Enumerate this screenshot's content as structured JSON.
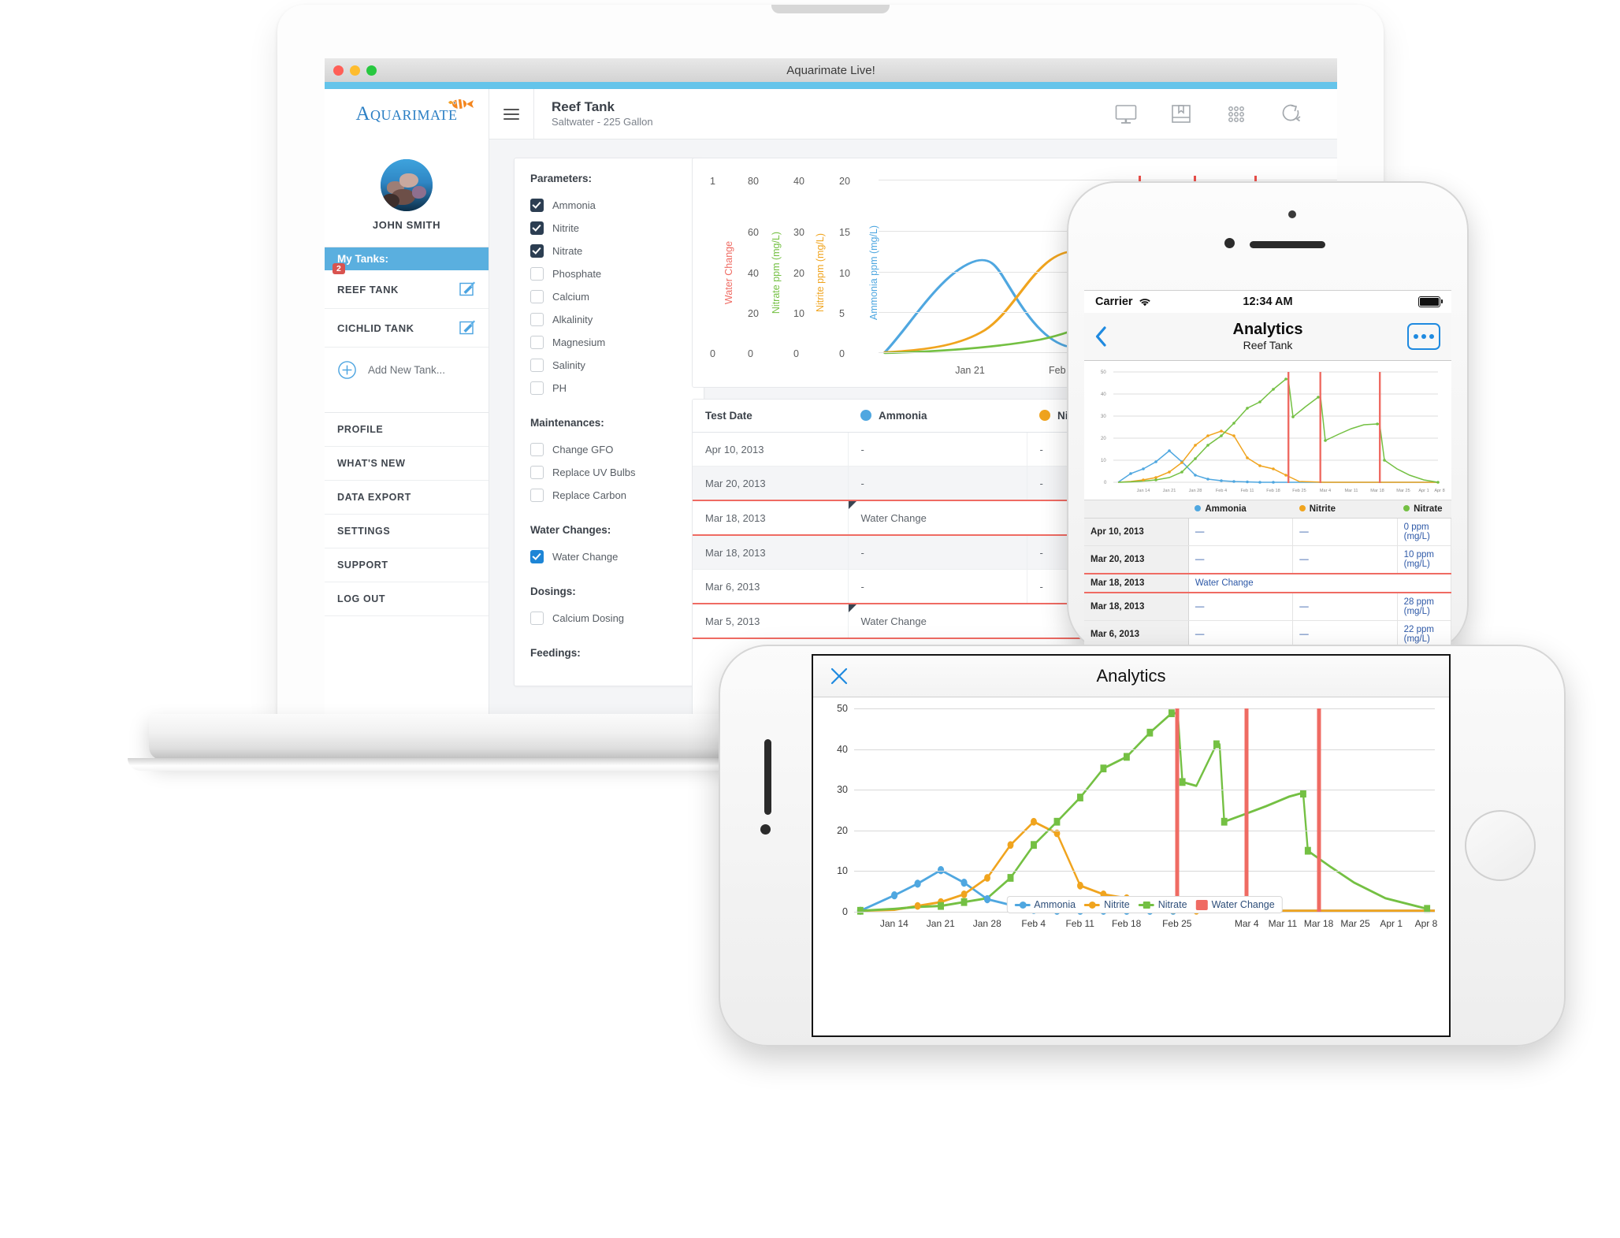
{
  "window": {
    "title": "Aquarimate Live!",
    "traffic_lights": [
      "close",
      "minimize",
      "zoom"
    ]
  },
  "brand": {
    "logo_text": "Aquarimate",
    "logo_icon": "clownfish-icon"
  },
  "header": {
    "menu_icon": "hamburger-icon",
    "tank_name": "Reef Tank",
    "tank_subtitle": "Saltwater - 225 Gallon",
    "icons": [
      "monitor-icon",
      "journal-icon",
      "grid-icon",
      "refresh-icon"
    ]
  },
  "sidebar": {
    "user_name": "JOHN SMITH",
    "section_label": "My Tanks:",
    "tanks": [
      {
        "label": "REEF TANK",
        "badge": "2",
        "edit_icon": "edit-pencil-icon"
      },
      {
        "label": "CICHLID TANK",
        "badge": "",
        "edit_icon": "edit-pencil-icon"
      }
    ],
    "add_tank_label": "Add New Tank...",
    "add_tank_icon": "plus-circle-icon",
    "nav": [
      "PROFILE",
      "WHAT'S NEW",
      "DATA EXPORT",
      "SETTINGS",
      "SUPPORT",
      "LOG OUT"
    ]
  },
  "filters": {
    "groups": [
      {
        "title": "Parameters:",
        "items": [
          {
            "label": "Ammonia",
            "checked": true,
            "style": "dark"
          },
          {
            "label": "Nitrite",
            "checked": true,
            "style": "dark"
          },
          {
            "label": "Nitrate",
            "checked": true,
            "style": "dark"
          },
          {
            "label": "Phosphate",
            "checked": false,
            "style": ""
          },
          {
            "label": "Calcium",
            "checked": false,
            "style": ""
          },
          {
            "label": "Alkalinity",
            "checked": false,
            "style": ""
          },
          {
            "label": "Magnesium",
            "checked": false,
            "style": ""
          },
          {
            "label": "Salinity",
            "checked": false,
            "style": ""
          },
          {
            "label": "PH",
            "checked": false,
            "style": ""
          }
        ]
      },
      {
        "title": "Maintenances:",
        "items": [
          {
            "label": "Change GFO",
            "checked": false,
            "style": ""
          },
          {
            "label": "Replace UV Bulbs",
            "checked": false,
            "style": ""
          },
          {
            "label": "Replace Carbon",
            "checked": false,
            "style": ""
          }
        ]
      },
      {
        "title": "Water Changes:",
        "items": [
          {
            "label": "Water Change",
            "checked": true,
            "style": "blue"
          }
        ]
      },
      {
        "title": "Dosings:",
        "items": [
          {
            "label": "Calcium Dosing",
            "checked": false,
            "style": ""
          }
        ]
      },
      {
        "title": "Feedings:",
        "items": []
      }
    ]
  },
  "desktop_table": {
    "columns": [
      "Test Date",
      "Ammonia",
      "Nitrite"
    ],
    "column_dot_colors": [
      "",
      "#4fa7e0",
      "#f0a41e"
    ],
    "rows": [
      {
        "date": "Apr 10, 2013",
        "ammonia": "-",
        "nitrite": "-",
        "type": "data"
      },
      {
        "date": "Mar 20, 2013",
        "ammonia": "-",
        "nitrite": "-",
        "type": "data"
      },
      {
        "date": "Mar 18, 2013",
        "ammonia": "Water Change",
        "nitrite": "",
        "type": "water_change"
      },
      {
        "date": "Mar 18, 2013",
        "ammonia": "-",
        "nitrite": "-",
        "type": "data"
      },
      {
        "date": "Mar 6, 2013",
        "ammonia": "-",
        "nitrite": "-",
        "type": "data"
      },
      {
        "date": "Mar 5, 2013",
        "ammonia": "Water Change",
        "nitrite": "",
        "type": "water_change"
      }
    ]
  },
  "phone_portrait": {
    "status": {
      "carrier": "Carrier",
      "wifi_icon": "wifi-icon",
      "time": "12:34 AM",
      "battery_icon": "battery-full-icon"
    },
    "nav": {
      "back_icon": "chevron-left-icon",
      "title": "Analytics",
      "subtitle": "Reef Tank",
      "more_icon": "more-dots-icon"
    },
    "table": {
      "columns": [
        "",
        "Ammonia",
        "Nitrite",
        "Nitrate"
      ],
      "column_dot_colors": [
        "",
        "#4fa7e0",
        "#f0a41e",
        "#74c043"
      ],
      "rows": [
        {
          "date": "Apr 10, 2013",
          "ammonia": "—",
          "nitrite": "—",
          "nitrate": "0 ppm (mg/L)",
          "type": "data"
        },
        {
          "date": "Mar 20, 2013",
          "ammonia": "—",
          "nitrite": "—",
          "nitrate": "10 ppm (mg/L)",
          "type": "data"
        },
        {
          "date": "Mar 18, 2013",
          "ammonia": "Water Change",
          "nitrite": "",
          "nitrate": "",
          "type": "water_change"
        },
        {
          "date": "Mar 18, 2013",
          "ammonia": "—",
          "nitrite": "—",
          "nitrate": "28 ppm (mg/L)",
          "type": "data"
        },
        {
          "date": "Mar 6, 2013",
          "ammonia": "—",
          "nitrite": "—",
          "nitrate": "22 ppm (mg/L)",
          "type": "data"
        }
      ]
    }
  },
  "phone_landscape": {
    "nav": {
      "close_icon": "close-x-icon",
      "title": "Analytics"
    }
  },
  "colors": {
    "ammonia": "#4fa7e0",
    "nitrite": "#f0a41e",
    "nitrate": "#74c043",
    "water_change": "#ef6b63",
    "accent": "#5aafdf",
    "brand_blue": "#2b7fc4",
    "badge_red": "#d9534f"
  },
  "chart_data": [
    {
      "id": "landscape_phone_chart",
      "type": "line",
      "title": "Analytics",
      "xlabel": "",
      "ylabel": "",
      "ylim": [
        0,
        50
      ],
      "yticks": [
        0,
        10,
        20,
        30,
        40,
        50
      ],
      "grid": true,
      "legend_position": "bottom",
      "x": [
        "Jan 7",
        "Jan 14",
        "Jan 17",
        "Jan 21",
        "Jan 24",
        "Jan 28",
        "Jan 31",
        "Feb 4",
        "Feb 8",
        "Feb 11",
        "Feb 14",
        "Feb 18",
        "Feb 21",
        "Feb 25",
        "Feb 25b",
        "Feb 28",
        "Mar 4",
        "Mar 4b",
        "Mar 8",
        "Mar 14",
        "Mar 18",
        "Mar 18b",
        "Mar 21",
        "Mar 25",
        "Apr 1",
        "Apr 8"
      ],
      "xticks": [
        "Jan 14",
        "Jan 21",
        "Jan 28",
        "Feb 4",
        "Feb 11",
        "Feb 18",
        "Feb 25",
        "Mar 4",
        "Mar 11",
        "Mar 18",
        "Mar 25",
        "Apr 1",
        "Apr 8"
      ],
      "series": [
        {
          "name": "Ammonia",
          "color": "#4fa7e0",
          "marker": "circle",
          "values": [
            0,
            4,
            6.8,
            10.1,
            7.1,
            3.1,
            1.5,
            0.5,
            0.15,
            0.1,
            0.1,
            0.1,
            0.05,
            0,
            0,
            0,
            0,
            0,
            0,
            0,
            0,
            0,
            0,
            0,
            0,
            0
          ]
        },
        {
          "name": "Nitrite",
          "color": "#f0a41e",
          "marker": "plus",
          "values": [
            0,
            0.3,
            1.1,
            2.2,
            4.1,
            8,
            16.1,
            22,
            19,
            6.2,
            4.1,
            3.1,
            1.7,
            0.15,
            0.1,
            0.1,
            0.05,
            0,
            0,
            0,
            0,
            0,
            0,
            0,
            0,
            0
          ]
        },
        {
          "name": "Nitrate",
          "color": "#74c043",
          "marker": "square",
          "values": [
            0.1,
            0.3,
            0.6,
            1.1,
            1.8,
            3.1,
            8,
            16.1,
            22,
            28,
            35,
            38,
            44,
            48.5,
            31.8,
            41,
            43,
            22,
            25.5,
            28.5,
            28.8,
            15.1,
            10,
            6,
            3,
            0.4
          ]
        }
      ],
      "water_change_lines": [
        "Feb 25",
        "Mar 4",
        "Mar 18"
      ],
      "water_change_color": "#ef6b63",
      "legend": [
        "Ammonia",
        "Nitrite",
        "Nitrate",
        "Water Change"
      ]
    },
    {
      "id": "desktop_multi_axis_chart",
      "type": "line",
      "title": "",
      "grid": true,
      "axes": [
        {
          "name": "Water Change",
          "color": "#ef6b63",
          "ticks": [
            "1",
            "",
            "",
            "",
            "0"
          ]
        },
        {
          "name": "Nitrate ppm (mg/L)",
          "color": "#74c043",
          "ticks": [
            "80",
            "60",
            "40",
            "20",
            "0"
          ]
        },
        {
          "name": "Nitrite ppm (mg/L)",
          "color": "#f0a41e",
          "ticks": [
            "40",
            "30",
            "20",
            "10",
            "0"
          ]
        },
        {
          "name": "Ammonia ppm (mg/L)",
          "color": "#4fa7e0",
          "ticks": [
            "20",
            "15",
            "10",
            "5",
            "0"
          ]
        }
      ],
      "xticks": [
        "Jan 21",
        "Feb 4"
      ],
      "series": [
        {
          "name": "Ammonia",
          "color": "#4fa7e0"
        },
        {
          "name": "Nitrite",
          "color": "#f0a41e"
        },
        {
          "name": "Nitrate",
          "color": "#74c043"
        }
      ]
    }
  ]
}
